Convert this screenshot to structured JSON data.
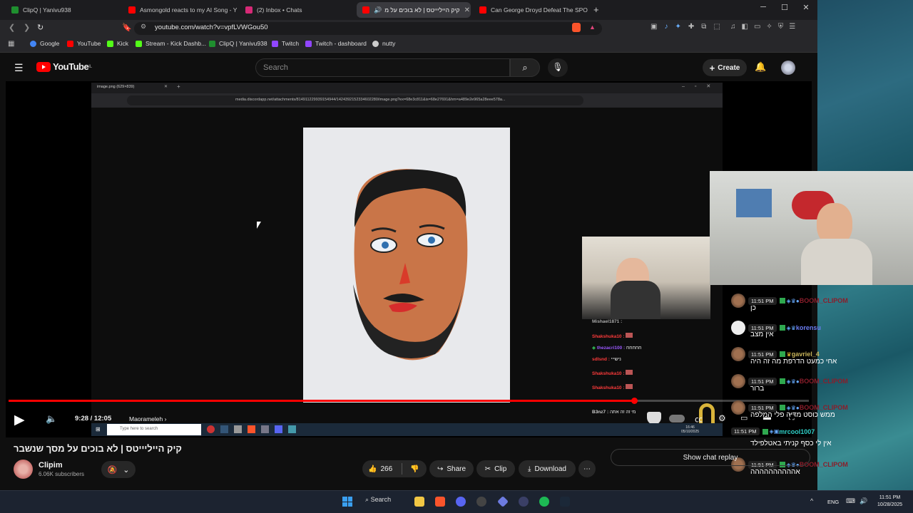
{
  "browser": {
    "tabs": [
      {
        "label": "ClipQ | Yanivu938",
        "color": "#1f8f2f"
      },
      {
        "label": "Asmongold reacts to my AI Song - Yo",
        "color": "#ff0000"
      },
      {
        "label": "(2) Inbox • Chats",
        "color": "#d62976"
      },
      {
        "label": "קיק הייליייטס | לא בוכים על מ",
        "color": "#ff0000",
        "active": true
      },
      {
        "label": "Can George Droyd Defeat The SPOO",
        "color": "#ff0000"
      }
    ],
    "url": "youtube.com/watch?v=vpfLVWGou50",
    "bookmarks": [
      "Google",
      "YouTube",
      "Kick",
      "Stream - Kick Dashb...",
      "ClipQ | Yanivu938",
      "Twitch",
      "Twitch - dashboard",
      "nutty"
    ]
  },
  "youtube": {
    "region": "IL",
    "logo": "YouTube",
    "search_placeholder": "Search",
    "create_label": "Create"
  },
  "inner": {
    "tab_label": "image.png (629×839)",
    "url": "media.discordapp.net/attachments/814911229939154944/1424392152334602280/image.png?ex=68e3c811&is=68e27691&hm=a489e2e965a28eee578a...",
    "taskbar_search": "Type here to search",
    "clock": "16:46",
    "date": "05/10/2025"
  },
  "player": {
    "time": "9:28 / 12:05",
    "chapter": "Maorameleh",
    "progress_fraction": 0.782
  },
  "stream_chat": [
    {
      "user": "Mishael1871 :",
      "msg": "",
      "color": "#aaaaaa"
    },
    {
      "user": "Shakshuka10 :",
      "msg": "",
      "color": "#ff3b3b"
    },
    {
      "user": "thezacri100 :",
      "msg": "חחחחח",
      "color": "#9b59ff"
    },
    {
      "user": "sdlsnd :",
      "msg": "נישייי",
      "color": "#ff3b3b"
    },
    {
      "user": "Shakshuka10 :",
      "msg": "",
      "color": "#ff3b3b"
    },
    {
      "user": "Shakshuka10 :",
      "msg": "",
      "color": "#ff3b3b"
    },
    {
      "user": "B3nz7 :",
      "msg": "מי זה זה אתה",
      "color": "#cccccc"
    }
  ],
  "chat_overlay": [
    {
      "time": "11:51 PM",
      "user": "BOOM_CLIPOM",
      "msg": "כן",
      "color": "#8b1d2a"
    },
    {
      "time": "11:51 PM",
      "user": "korensu",
      "msg": "אין מצב",
      "color": "#6c7ef5"
    },
    {
      "time": "11:51 PM",
      "user": "gavriel_4",
      "msg": "אחי כמעט הדרפת מה זה היה",
      "color": "#c8b45a"
    },
    {
      "time": "11:51 PM",
      "user": "BOOM_CLIPOM",
      "msg": "ברור",
      "color": "#8b1d2a"
    },
    {
      "time": "11:51 PM",
      "user": "BOOM_CLIPOM",
      "msg": "ממש כוסט מדיה פלי המלפה",
      "color": "#8b1d2a"
    },
    {
      "time": "11:51 PM",
      "user": "mrcool1007",
      "msg": "אין לי כסף קניתי באטלפילד",
      "color": "#2fd0c8"
    },
    {
      "time": "11:51 PM",
      "user": "BOOM_CLIPOM",
      "msg": "אהההההההההה",
      "color": "#8b1d2a"
    },
    {
      "time": "11:51 PM",
      "user": "BOOM_CLIPOM",
      "msg": "אחאהההההההההה",
      "color": "#8b1d2a"
    }
  ],
  "video": {
    "title": "קיק הייליייטס | לא בוכים על מסך שנשבר",
    "channel": "Clipim",
    "subscribers": "6.06K subscribers",
    "likes": "266",
    "share_label": "Share",
    "clip_label": "Clip",
    "download_label": "Download",
    "show_chat_replay": "Show chat replay"
  },
  "taskbar": {
    "search_label": "Search",
    "lang": "ENG",
    "time": "11:51 PM",
    "date": "10/28/2025"
  }
}
